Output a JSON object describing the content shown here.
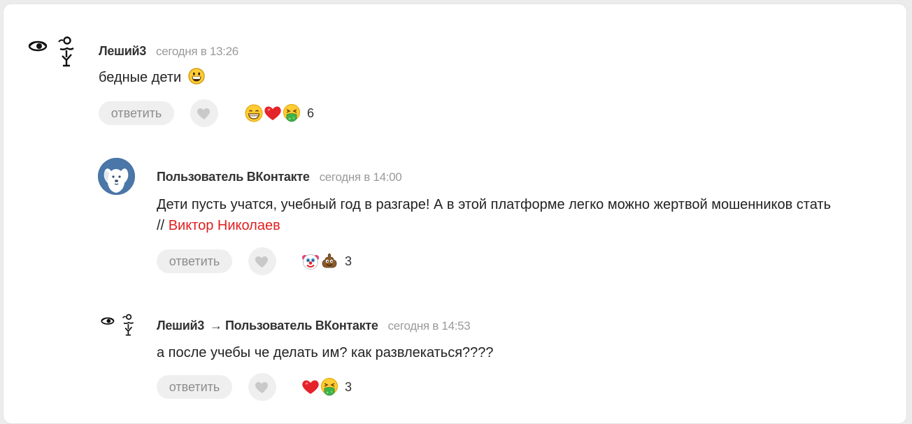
{
  "comments": [
    {
      "author": "Леший3",
      "time": "сегодня в 13:26",
      "text": "бедные дети",
      "text_emoji": "grinning-face",
      "reply_label": "ответить",
      "reactions": [
        "grinning-smiling-eyes",
        "red-heart",
        "vomiting-face"
      ],
      "reaction_count": "6"
    },
    {
      "author": "Пользователь ВКонтакте",
      "time": "сегодня в 14:00",
      "text_line1": "Дети пусть учатся, учебный год в разгаре! А в этой платформе легко можно жертвой мошенников стать",
      "text_prefix": "//",
      "link": "Виктор Николаев",
      "reply_label": "ответить",
      "reactions": [
        "clown-face",
        "pile-of-poo"
      ],
      "reaction_count": "3"
    },
    {
      "author": "Леший3",
      "arrow": "→",
      "reply_to": "Пользователь ВКонтакте",
      "time": "сегодня в 14:53",
      "text": "а после учебы че делать им? как развлекаться????",
      "reply_label": "ответить",
      "reactions": [
        "red-heart",
        "vomiting-face"
      ],
      "reaction_count": "3"
    }
  ],
  "colors": {
    "link": "#e01f1f",
    "time": "#9a9a9a",
    "button_bg": "#efefef",
    "vk_avatar": "#4a76a8"
  }
}
